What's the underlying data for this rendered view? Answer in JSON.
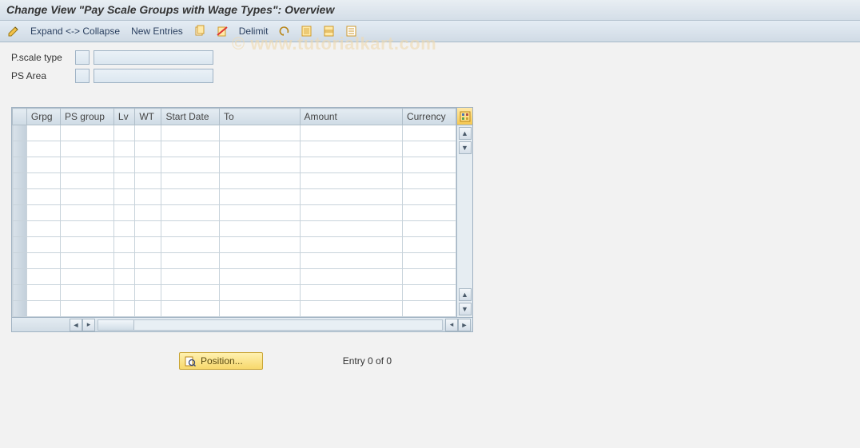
{
  "title": "Change View \"Pay Scale Groups with Wage Types\": Overview",
  "toolbar": {
    "expand_collapse": "Expand <-> Collapse",
    "new_entries": "New Entries",
    "delimit": "Delimit",
    "icons": {
      "pencil": "change-icon",
      "copy": "copy-icon",
      "delete": "delete-icon",
      "undo": "undo-icon",
      "select_all": "select-all-icon",
      "select_block": "select-block-icon",
      "deselect": "deselect-icon"
    }
  },
  "filters": {
    "pscale_type_label": "P.scale type",
    "pscale_type_short": "",
    "pscale_type_value": "",
    "ps_area_label": "PS Area",
    "ps_area_short": "",
    "ps_area_value": ""
  },
  "grid": {
    "columns": [
      "Grpg",
      "PS group",
      "Lv",
      "WT",
      "Start Date",
      "To",
      "Amount",
      "Currency"
    ],
    "row_count": 12
  },
  "footer": {
    "position_label": "Position...",
    "entry_text": "Entry 0 of 0"
  },
  "watermark": "© www.tutorialkart.com"
}
